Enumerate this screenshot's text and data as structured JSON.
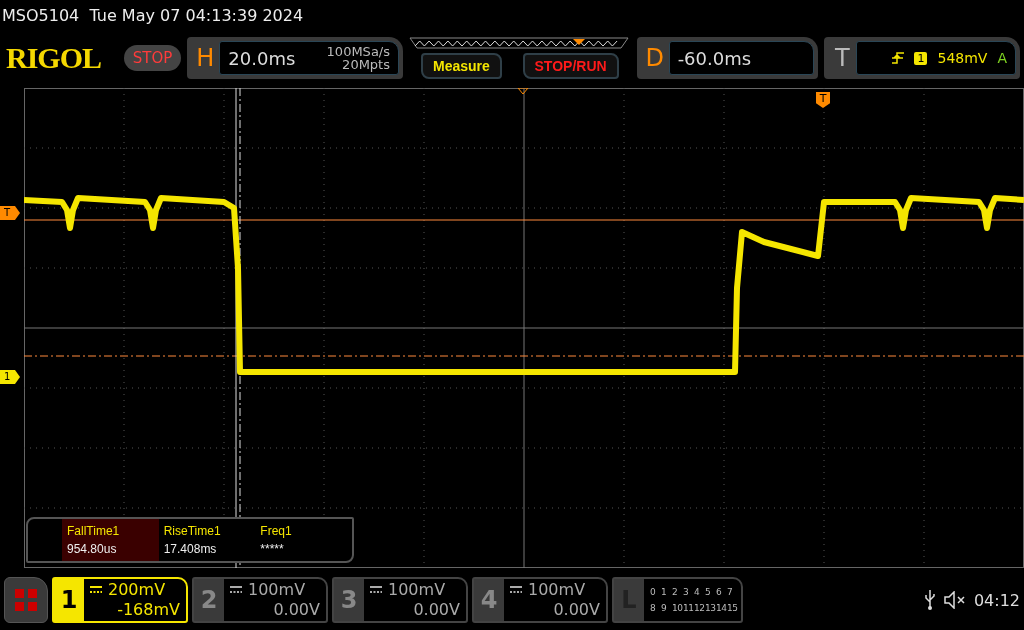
{
  "status_line": "MSO5104  Tue May 07 04:13:39 2024",
  "logo": "RIGOL",
  "run_state": "STOP",
  "horizontal": {
    "label": "H",
    "timebase": "20.0ms",
    "sample_rate": "100MSa/s",
    "memory_depth": "20Mpts"
  },
  "buttons": [
    {
      "label": "Measure",
      "kind": "measure"
    },
    {
      "label": "STOP/RUN",
      "kind": "run"
    }
  ],
  "delay": {
    "label": "D",
    "value": "-60.0ms"
  },
  "trigger": {
    "label": "T",
    "source": "1",
    "level": "548mV",
    "mode": "A"
  },
  "markers": {
    "trigger_level": "T",
    "channel": "1",
    "trigger_position": "T"
  },
  "measurements": [
    {
      "name": "FallTime1",
      "value": "954.80us",
      "selected": true
    },
    {
      "name": "RiseTime1",
      "value": "17.408ms",
      "selected": false
    },
    {
      "name": "Freq1",
      "value": "*****",
      "selected": false
    }
  ],
  "channels": [
    {
      "number": "1",
      "scale": "200mV",
      "offset": "-168mV",
      "selected": true
    },
    {
      "number": "2",
      "scale": "100mV",
      "offset": "0.00V",
      "selected": false
    },
    {
      "number": "3",
      "scale": "100mV",
      "offset": "0.00V",
      "selected": false
    },
    {
      "number": "4",
      "scale": "100mV",
      "offset": "0.00V",
      "selected": false
    }
  ],
  "logic": {
    "label": "L",
    "rows": [
      [
        "0",
        "1",
        "2",
        "3",
        "4",
        "5",
        "6",
        "7"
      ],
      [
        "8",
        "9",
        "10",
        "11",
        "12",
        "13",
        "14",
        "15"
      ]
    ]
  },
  "clock": "04:12"
}
